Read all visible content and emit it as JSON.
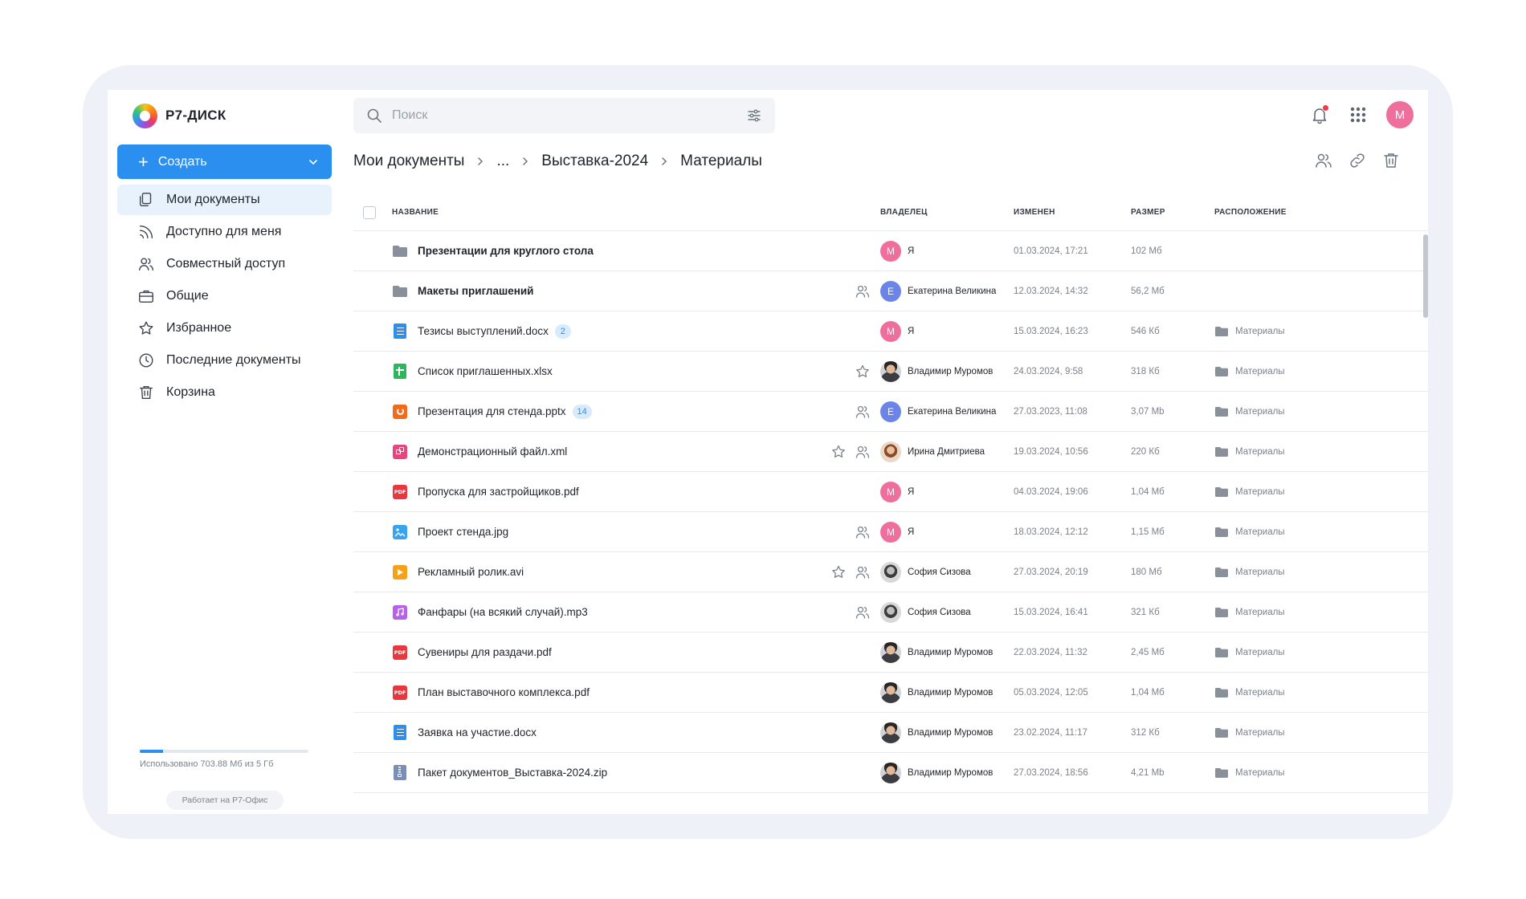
{
  "app": {
    "logo_text": "Р7-ДИСК"
  },
  "sidebar": {
    "create_label": "Создать",
    "items": [
      {
        "label": "Мои документы",
        "icon": "documents-icon",
        "active": true
      },
      {
        "label": "Доступно для меня",
        "icon": "rss-icon"
      },
      {
        "label": "Совместный доступ",
        "icon": "users-icon"
      },
      {
        "label": "Общие",
        "icon": "briefcase-icon"
      },
      {
        "label": "Избранное",
        "icon": "star-icon"
      },
      {
        "label": "Последние документы",
        "icon": "clock-icon"
      },
      {
        "label": "Корзина",
        "icon": "trash-icon"
      }
    ],
    "storage_text": "Использовано 703.88 Мб из 5 Гб",
    "storage_fraction": 0.1375,
    "powered_by": "Работает на Р7-Офис"
  },
  "header": {
    "search_placeholder": "Поиск",
    "user_initial": "М"
  },
  "breadcrumb": [
    "Мои документы",
    "...",
    "Выставка-2024",
    "Материалы"
  ],
  "table": {
    "columns": [
      "НАЗВАНИЕ",
      "ВЛАДЕЛЕЦ",
      "ИЗМЕНЕН",
      "РАЗМЕР",
      "РАСПОЛОЖЕНИЕ"
    ],
    "rows": [
      {
        "name": "Презентации для круглого стола",
        "type": "folder",
        "bold": true,
        "owner": "Я",
        "owner_initial": "М",
        "owner_color": "#ee6f9b",
        "modified": "01.03.2024, 17:21",
        "size": "102 Мб",
        "location": ""
      },
      {
        "name": "Макеты приглашений",
        "type": "folder",
        "bold": true,
        "shared": true,
        "owner": "Екатерина Великина",
        "owner_initial": "Е",
        "owner_color": "#6b84e8",
        "modified": "12.03.2024, 14:32",
        "size": "56,2 Мб",
        "location": ""
      },
      {
        "name": "Тезисы выступлений.docx",
        "type": "docx",
        "badge": "2",
        "owner": "Я",
        "owner_initial": "М",
        "owner_color": "#ee6f9b",
        "modified": "15.03.2024, 16:23",
        "size": "546 Кб",
        "location": "Материалы"
      },
      {
        "name": "Список приглашенных.xlsx",
        "type": "xlsx",
        "star": true,
        "owner": "Владимир Муромов",
        "owner_photo": "man",
        "modified": "24.03.2024, 9:58",
        "size": "318 Кб",
        "location": "Материалы"
      },
      {
        "name": "Презентация для стенда.pptx",
        "type": "pptx",
        "badge": "14",
        "shared": true,
        "owner": "Екатерина Великина",
        "owner_initial": "Е",
        "owner_color": "#6b84e8",
        "modified": "27.03.2023, 11:08",
        "size": "3,07 Mb",
        "location": "Материалы"
      },
      {
        "name": "Демонстрационный файл.xml",
        "type": "xml",
        "star": true,
        "shared": true,
        "owner": "Ирина Дмитриева",
        "owner_photo": "woman",
        "modified": "19.03.2024, 10:56",
        "size": "220 Кб",
        "location": "Материалы"
      },
      {
        "name": "Пропуска для застройщиков.pdf",
        "type": "pdf",
        "owner": "Я",
        "owner_initial": "М",
        "owner_color": "#ee6f9b",
        "modified": "04.03.2024, 19:06",
        "size": "1,04 Мб",
        "location": "Материалы"
      },
      {
        "name": "Проект стенда.jpg",
        "type": "jpg",
        "shared": true,
        "owner": "Я",
        "owner_initial": "М",
        "owner_color": "#ee6f9b",
        "modified": "18.03.2024, 12:12",
        "size": "1,15 Мб",
        "location": "Материалы"
      },
      {
        "name": "Рекламный ролик.avi",
        "type": "avi",
        "star": true,
        "shared": true,
        "owner": "София Сизова",
        "owner_photo": "grey",
        "modified": "27.03.2024, 20:19",
        "size": "180 Мб",
        "location": "Материалы"
      },
      {
        "name": "Фанфары (на всякий случай).mp3",
        "type": "mp3",
        "shared": true,
        "owner": "София Сизова",
        "owner_photo": "grey",
        "modified": "15.03.2024, 16:41",
        "size": "321 Кб",
        "location": "Материалы"
      },
      {
        "name": "Сувениры для раздачи.pdf",
        "type": "pdf",
        "owner": "Владимир Муромов",
        "owner_photo": "man",
        "modified": "22.03.2024, 11:32",
        "size": "2,45 Мб",
        "location": "Материалы"
      },
      {
        "name": "План выставочного комплекса.pdf",
        "type": "pdf",
        "owner": "Владимир Муромов",
        "owner_photo": "man",
        "modified": "05.03.2024, 12:05",
        "size": "1,04 Мб",
        "location": "Материалы"
      },
      {
        "name": "Заявка на участие.docx",
        "type": "docx",
        "owner": "Владимир Муромов",
        "owner_photo": "man",
        "modified": "23.02.2024, 11:17",
        "size": "312 Кб",
        "location": "Материалы"
      },
      {
        "name": "Пакет документов_Выставка-2024.zip",
        "type": "zip",
        "owner": "Владимир Муромов",
        "owner_photo": "man",
        "modified": "27.03.2024, 18:56",
        "size": "4,21 Mb",
        "location": "Материалы"
      }
    ]
  },
  "colors": {
    "accent": "#2b8ff0",
    "docx": "#2b8ff0",
    "xlsx": "#2fb55e",
    "pptx": "#f26b1d",
    "xml": "#e8457f",
    "pdf": "#e8383d",
    "jpg": "#3aa3f0",
    "avi": "#f5a21a",
    "mp3": "#b562e8",
    "zip": "#7a8fb8",
    "folder": "#8a9099"
  }
}
